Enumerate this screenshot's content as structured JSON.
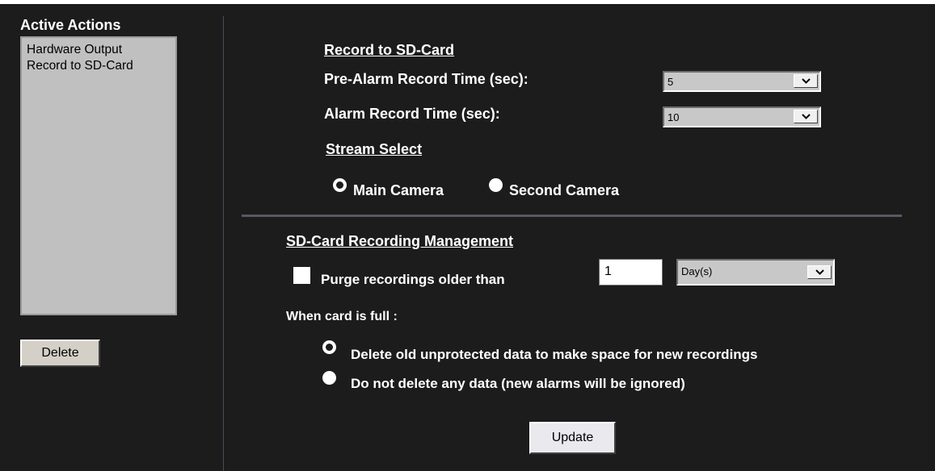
{
  "left": {
    "title": "Active Actions",
    "actions": [
      "Hardware Output",
      "Record to SD-Card"
    ],
    "delete_label": "Delete"
  },
  "record": {
    "heading": "Record to SD-Card",
    "pre_alarm_label": "Pre-Alarm Record Time (sec):",
    "pre_alarm_value": "5",
    "alarm_label": "Alarm Record Time (sec):",
    "alarm_value": "10"
  },
  "stream": {
    "heading": "Stream Select",
    "options": [
      {
        "label": "Main Camera",
        "selected": true
      },
      {
        "label": "Second Camera",
        "selected": false
      }
    ]
  },
  "management": {
    "heading": "SD-Card Recording Management",
    "purge_label": "Purge recordings older than",
    "purge_checked": false,
    "purge_value": "1",
    "purge_unit": "Day(s)",
    "full_label": "When card is full :",
    "full_options": [
      {
        "label": "Delete old unprotected data to make space for new recordings",
        "selected": true
      },
      {
        "label": "Do not delete any data (new alarms will be ignored)",
        "selected": false
      }
    ]
  },
  "update_label": "Update",
  "colors": {
    "background": "#1c1c1c",
    "text": "#ffffff",
    "list_bg": "#c0c0c0",
    "separator": "#5a5766"
  },
  "icons": {
    "dropdown": "chevron-down-icon"
  }
}
